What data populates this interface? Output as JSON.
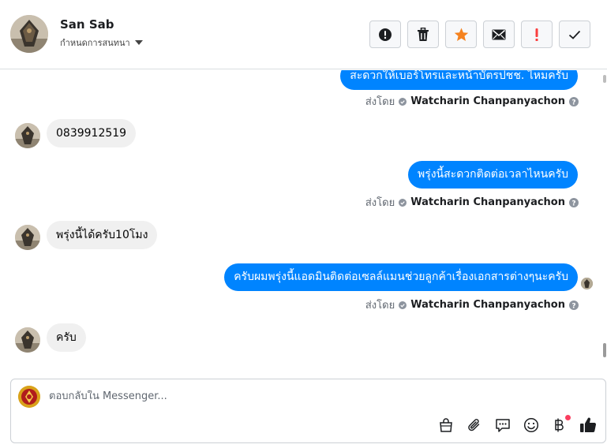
{
  "header": {
    "contact_name": "San Sab",
    "subtitle": "กำหนดการสนทนา"
  },
  "toolbar": {
    "icons": [
      "alert-circle-icon",
      "trash-icon",
      "star-icon",
      "envelope-icon",
      "exclamation-icon",
      "check-icon"
    ],
    "star_color": "#f5821f",
    "exclamation_color": "#fa3e3e"
  },
  "messages": [
    {
      "direction": "out",
      "text": "สะดวกให้เบอร์โทรและหน้าบัตรปชช. ไหมครับ",
      "sent_by_label": "ส่งโดย",
      "agent": "Watcharin Chanpanyachon"
    },
    {
      "direction": "in",
      "text": "0839912519"
    },
    {
      "direction": "out",
      "text": "พรุ่งนี้สะดวกติดต่อเวลาไหนครับ",
      "sent_by_label": "ส่งโดย",
      "agent": "Watcharin Chanpanyachon"
    },
    {
      "direction": "in",
      "text": "พรุ่งนี้ได้ครับ10โมง"
    },
    {
      "direction": "out",
      "text": "ครับผมพรุ่งนี้แอดมินติดต่อเซลล์แมนช่วยลูกค้าเรื่องเอกสารต่างๆนะครับ",
      "sent_by_label": "ส่งโดย",
      "agent": "Watcharin Chanpanyachon"
    },
    {
      "direction": "in",
      "text": "ครับ"
    }
  ],
  "composer": {
    "placeholder": "ตอบกลับใน Messenger...",
    "tools": [
      "shopping-bag-icon",
      "paperclip-icon",
      "saved-replies-icon",
      "emoji-icon",
      "baht-icon",
      "thumbs-up-icon"
    ]
  },
  "colors": {
    "outgoing_bubble": "#0084ff",
    "incoming_bubble": "#f0f0f0",
    "thumbs_up": "#1c1e21"
  }
}
